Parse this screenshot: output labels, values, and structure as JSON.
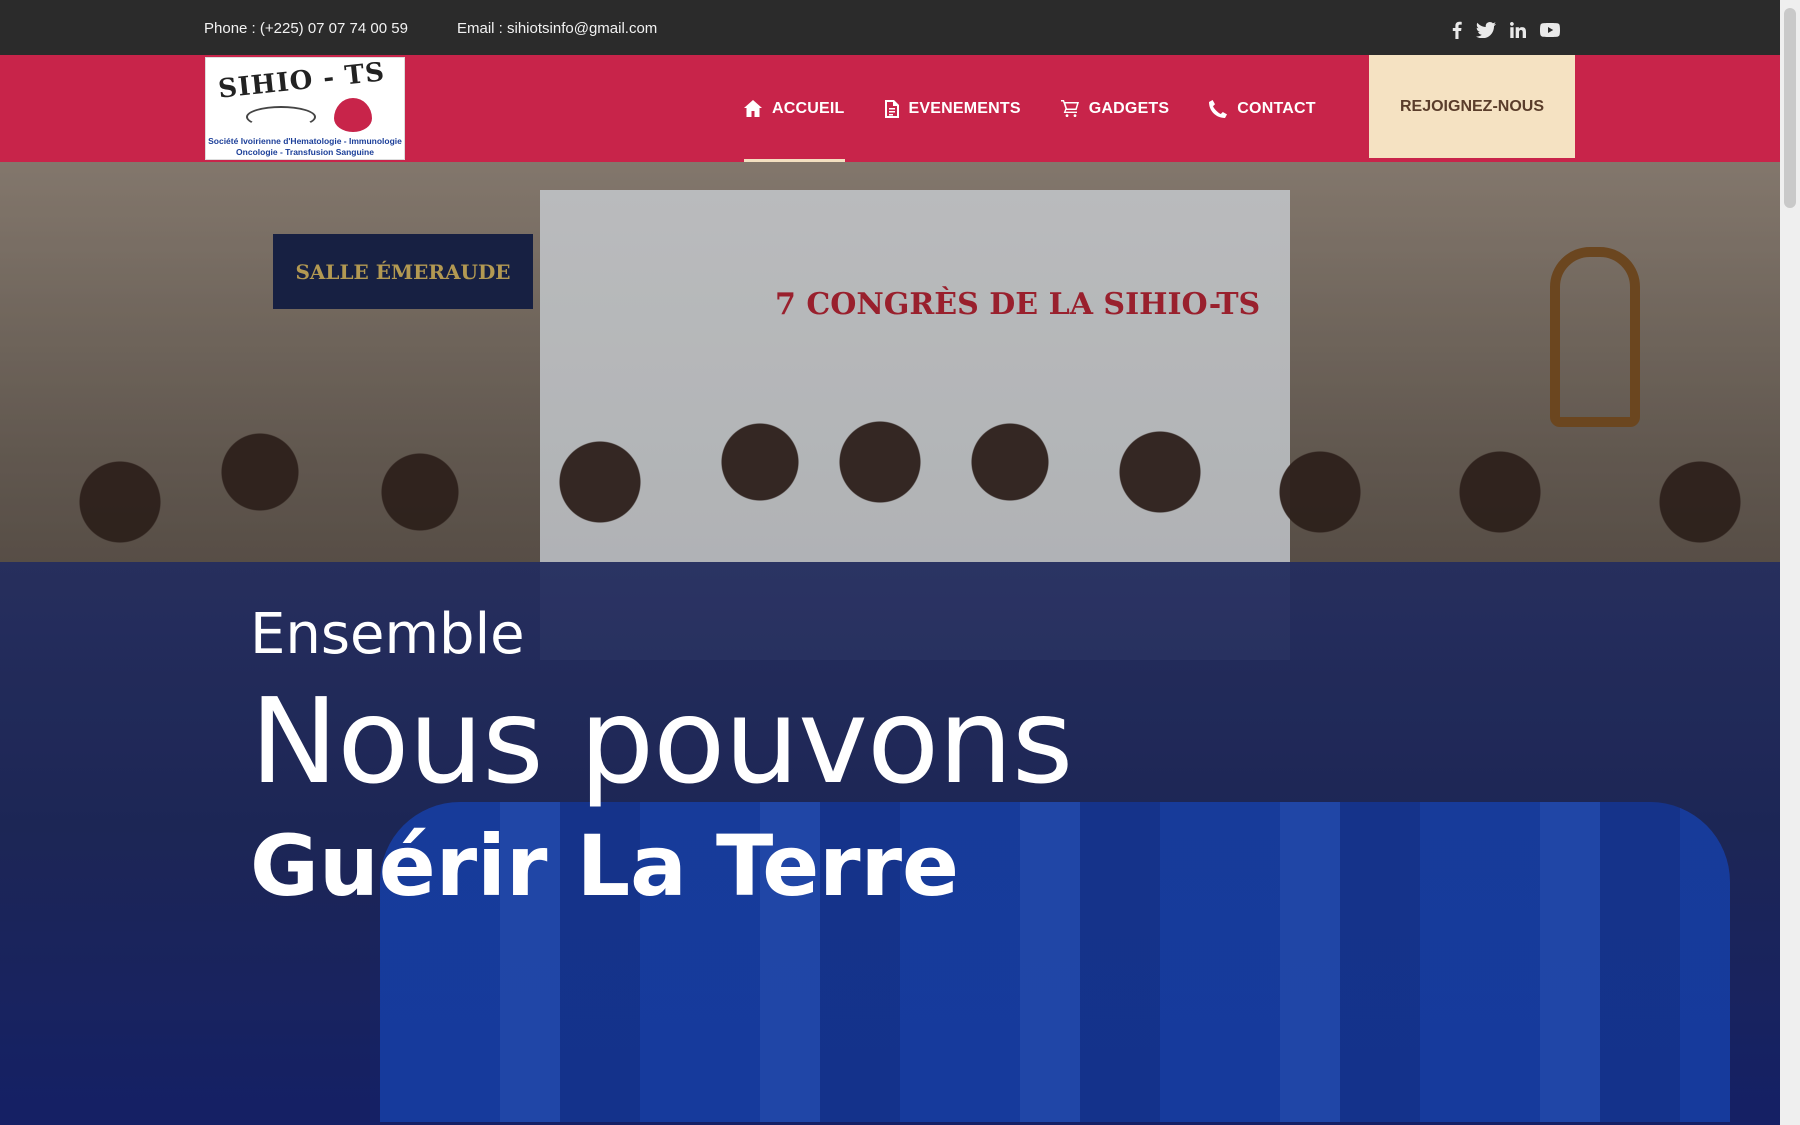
{
  "topbar": {
    "phone": "Phone : (+225) 07 07 74 00 59",
    "email": "Email : sihiotsinfo@gmail.com",
    "social": [
      "facebook-icon",
      "twitter-icon",
      "linkedin-icon",
      "youtube-icon"
    ]
  },
  "header": {
    "logo": {
      "brand": "SIHIO - TS",
      "line1": "Société Ivoirienne d'Hematologie - Immunologie",
      "line2": "Oncologie - Transfusion Sanguine"
    },
    "nav": [
      {
        "label": "ACCUEIL",
        "icon": "home-icon",
        "active": true
      },
      {
        "label": "EVENEMENTS",
        "icon": "document-icon",
        "active": false
      },
      {
        "label": "GADGETS",
        "icon": "cart-icon",
        "active": false
      },
      {
        "label": "CONTACT",
        "icon": "phone-icon",
        "active": false
      }
    ],
    "cta": "REJOIGNEZ-NOUS"
  },
  "hero": {
    "small": "Ensemble",
    "big": "Nous pouvons",
    "bold": "Guérir La Terre",
    "photo": {
      "sign": "SALLE ÉMERAUDE",
      "banner": "7 CONGRÈS DE LA SIHIO-TS"
    }
  },
  "colors": {
    "topbar": "#2b2b2b",
    "header": "#c8244a",
    "cta_bg": "#f5e2c2",
    "cta_text": "#5a3d2b",
    "active_underline": "#f3dfc0"
  }
}
